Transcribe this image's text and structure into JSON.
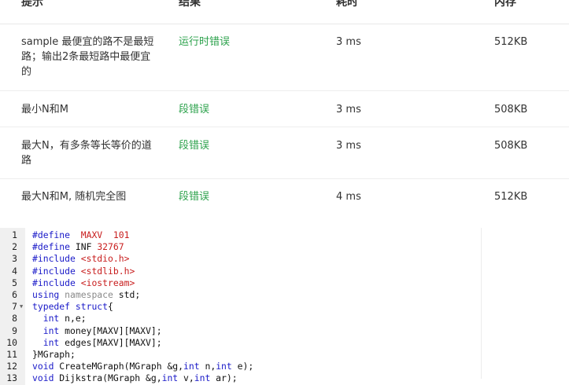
{
  "table": {
    "headers": [
      "提示",
      "结果",
      "耗时",
      "内存"
    ],
    "rows": [
      {
        "hint": "sample 最便宜的路不是最短路；输出2条最短路中最便宜的",
        "hint_lines": [
          "sample 最便宜的路不是最短",
          "路；输出2条最短路中最便宜",
          "的"
        ],
        "result": "运行时错误",
        "time": "3 ms",
        "memory": "512KB"
      },
      {
        "hint": "最小N和M",
        "hint_lines": [
          "最小N和M"
        ],
        "result": "段错误",
        "time": "3 ms",
        "memory": "508KB"
      },
      {
        "hint": "最大N，有多条等长等价的道路",
        "hint_lines": [
          "最大N，有多条等长等价的道",
          "路"
        ],
        "result": "段错误",
        "time": "3 ms",
        "memory": "508KB"
      },
      {
        "hint": "最大N和M, 随机完全图",
        "hint_lines": [
          "最大N和M, 随机完全图"
        ],
        "result": "段错误",
        "time": "4 ms",
        "memory": "512KB"
      }
    ]
  },
  "colors": {
    "result_error": "#2ca24c",
    "keyword": "#1919c8",
    "literal": "#c81e1e"
  },
  "code": {
    "fold_icon": "fold-triangle-icon",
    "lines": [
      {
        "n": "1",
        "t": "#define  MAXV  101"
      },
      {
        "n": "2",
        "t": "#define INF 32767"
      },
      {
        "n": "3",
        "t": "#include <stdio.h>"
      },
      {
        "n": "4",
        "t": "#include <stdlib.h>"
      },
      {
        "n": "5",
        "t": "#include <iostream>"
      },
      {
        "n": "6",
        "t": "using namespace std;"
      },
      {
        "n": "7",
        "t": "typedef struct{",
        "fold": true
      },
      {
        "n": "8",
        "t": "  int n,e;"
      },
      {
        "n": "9",
        "t": "  int money[MAXV][MAXV];"
      },
      {
        "n": "10",
        "t": "  int edges[MAXV][MAXV];"
      },
      {
        "n": "11",
        "t": "}MGraph;"
      },
      {
        "n": "12",
        "t": "void CreateMGraph(MGraph &g,int n,int e);"
      },
      {
        "n": "13",
        "t": "void Dijkstra(MGraph &g,int v,int ar);"
      }
    ]
  }
}
